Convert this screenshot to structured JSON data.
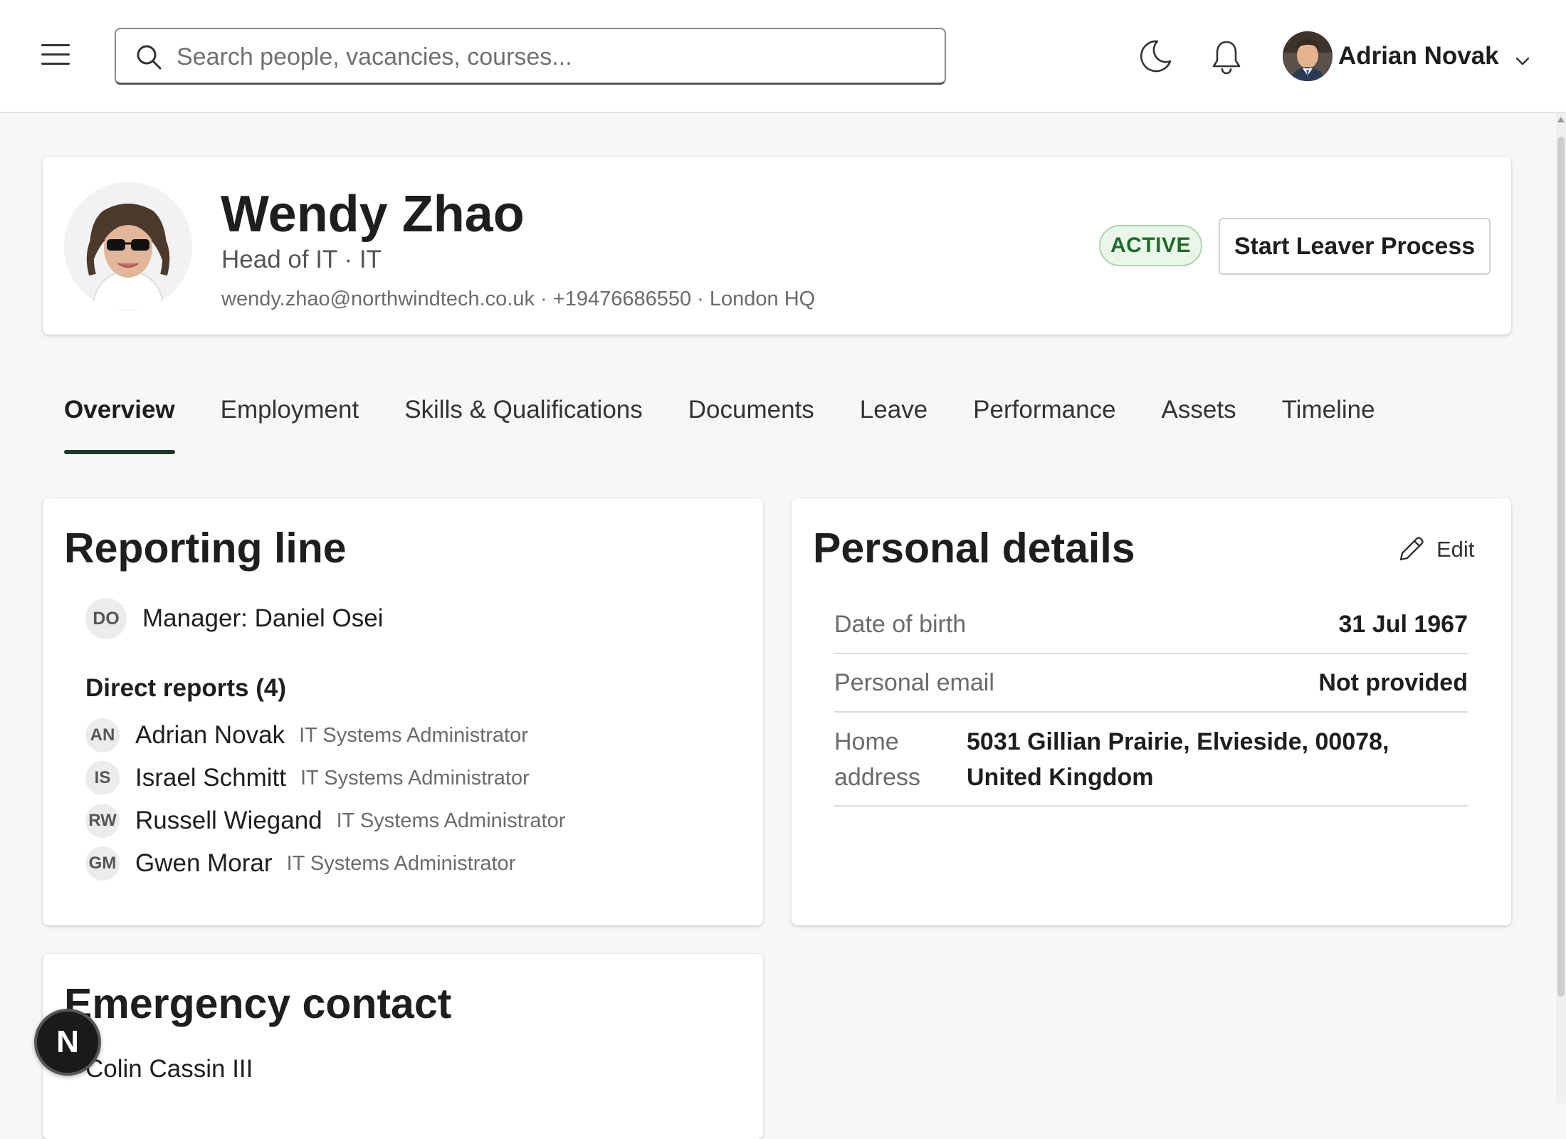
{
  "header": {
    "search_placeholder": "Search people, vacancies, courses...",
    "user_name": "Adrian Novak"
  },
  "profile": {
    "name": "Wendy Zhao",
    "role_line": "Head of IT · IT",
    "contact_line": "wendy.zhao@northwindtech.co.uk · +19476686550 · London HQ",
    "status": "ACTIVE",
    "action_label": "Start Leaver Process"
  },
  "tabs": [
    {
      "label": "Overview",
      "active": true
    },
    {
      "label": "Employment"
    },
    {
      "label": "Skills & Qualifications"
    },
    {
      "label": "Documents"
    },
    {
      "label": "Leave"
    },
    {
      "label": "Performance"
    },
    {
      "label": "Assets"
    },
    {
      "label": "Timeline"
    }
  ],
  "reporting": {
    "title": "Reporting line",
    "manager_initials": "DO",
    "manager_label": "Manager: Daniel Osei",
    "reports_heading": "Direct reports (4)",
    "reports": [
      {
        "initials": "AN",
        "name": "Adrian Novak",
        "title": "IT Systems Administrator"
      },
      {
        "initials": "IS",
        "name": "Israel Schmitt",
        "title": "IT Systems Administrator"
      },
      {
        "initials": "RW",
        "name": "Russell Wiegand",
        "title": "IT Systems Administrator"
      },
      {
        "initials": "GM",
        "name": "Gwen Morar",
        "title": "IT Systems Administrator"
      }
    ]
  },
  "personal": {
    "title": "Personal details",
    "edit_label": "Edit",
    "rows": [
      {
        "label": "Date of birth",
        "value": "31 Jul 1967"
      },
      {
        "label": "Personal email",
        "value": "Not provided"
      },
      {
        "label": "Home address",
        "value": "5031 Gillian Prairie, Elvieside, 00078, United Kingdom"
      }
    ]
  },
  "emergency": {
    "title": "Emergency contact",
    "name": "Colin Cassin III"
  },
  "fab_label": "N",
  "colors": {
    "accent": "#1d3b26",
    "status_text": "#1e6b2a",
    "status_bg": "#eaf6ea",
    "status_border": "#a9d6a9"
  },
  "icons": [
    "menu-icon",
    "search-icon",
    "moon-icon",
    "bell-icon",
    "chevron-down-icon",
    "pencil-icon"
  ]
}
